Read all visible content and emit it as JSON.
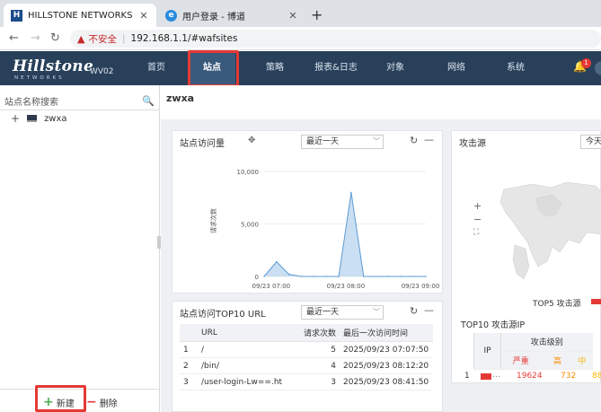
{
  "browser": {
    "tabs": [
      {
        "title": "HILLSTONE NETWORKS",
        "favicon": "hillstone-icon"
      },
      {
        "title": "用户登录 - 博道",
        "favicon": "globe-icon"
      }
    ],
    "address": {
      "insecure_label": "不安全",
      "url": "192.168.1.1/#wafsites"
    }
  },
  "header": {
    "logo": "Hillstone",
    "logo_sub": "NETWORKS",
    "model": "WV02",
    "menu": [
      "首页",
      "站点",
      "策略",
      "报表&日志",
      "对象",
      "网络",
      "系统"
    ],
    "active_menu": "站点",
    "notification_count": "1"
  },
  "sidebar": {
    "search_placeholder": "站点名称搜索",
    "tree": [
      {
        "label": "zwxa"
      }
    ],
    "new_label": "新建",
    "delete_label": "删除"
  },
  "main": {
    "site_title": "zwxa",
    "visits_card": {
      "title": "站点访问量",
      "range": "最近一天",
      "ylabel": "请求次数"
    },
    "top_url_card": {
      "title": "站点访问TOP10 URL",
      "range": "最近一天",
      "columns": [
        "URL",
        "请求次数",
        "最后一次访问时间"
      ],
      "rows": [
        {
          "idx": "1",
          "url": "/",
          "count": "5",
          "time": "2025/09/23 07:07:50"
        },
        {
          "idx": "2",
          "url": "/bin/",
          "count": "4",
          "time": "2025/09/23 08:12:20"
        },
        {
          "idx": "3",
          "url": "/user-login-Lw==.ht",
          "count": "3",
          "time": "2025/09/23 08:41:50"
        }
      ]
    },
    "attack_card": {
      "title": "攻击源",
      "range": "今天",
      "legend": "TOP5 攻击源",
      "top10_title": "TOP10 攻击源IP",
      "columns": {
        "ip": "IP",
        "level": "攻击级别",
        "severe": "严重",
        "high": "高",
        "medium": "中"
      },
      "rows": [
        {
          "idx": "1",
          "severe": "19624",
          "high": "732",
          "medium": "88"
        }
      ]
    }
  },
  "chart_data": {
    "type": "area",
    "title": "站点访问量",
    "ylabel": "请求次数",
    "xlabel": "",
    "ylim": [
      0,
      10000
    ],
    "yticks": [
      "10,000",
      "5,000",
      "0"
    ],
    "xticks": [
      "09/23 07:00",
      "09/23 08:00",
      "09/23 09:00"
    ],
    "x": [
      "06:45",
      "07:00",
      "07:10",
      "07:20",
      "07:30",
      "07:40",
      "07:50",
      "08:00",
      "08:10",
      "08:20",
      "08:30",
      "08:40",
      "08:50",
      "09:00"
    ],
    "values": [
      0,
      1400,
      200,
      0,
      0,
      0,
      0,
      8000,
      0,
      0,
      0,
      0,
      0,
      0
    ],
    "grid": true,
    "colors": {
      "line": "#5b9bd5",
      "fill": "#bdd7ee"
    }
  }
}
